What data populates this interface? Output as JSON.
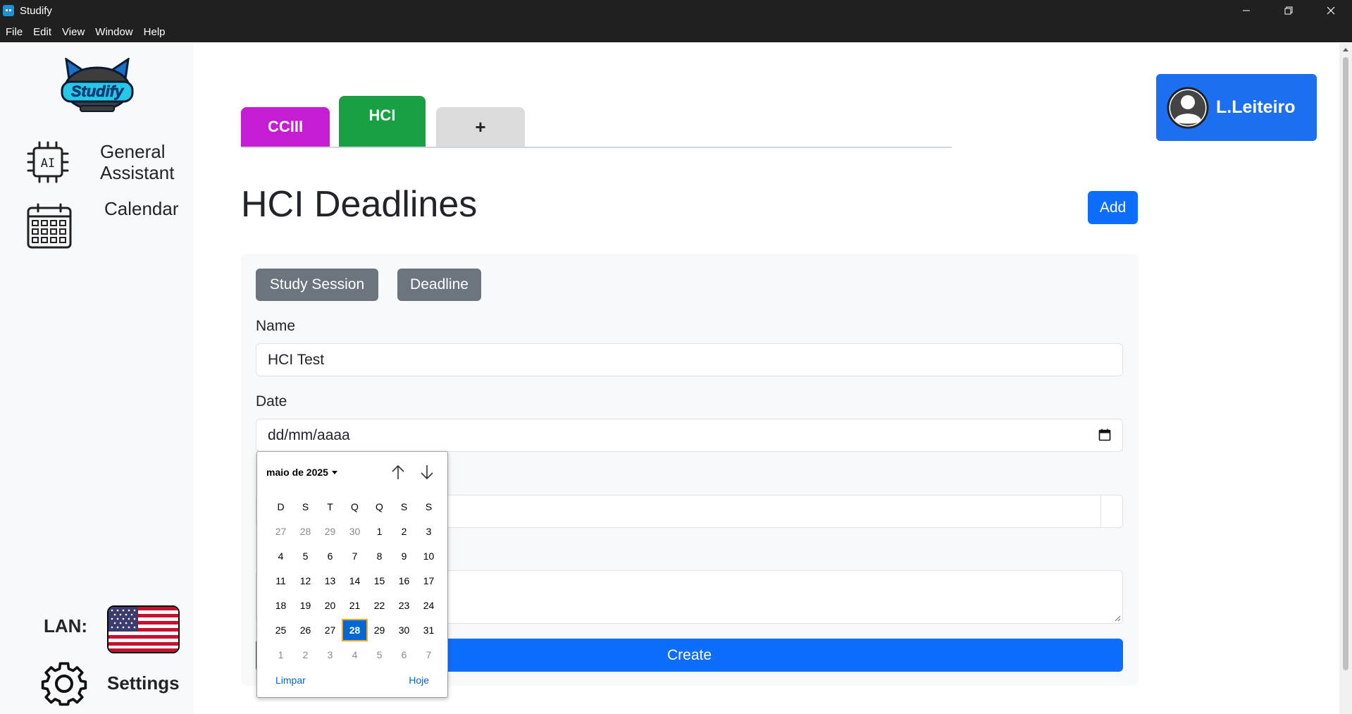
{
  "window": {
    "title": "Studify",
    "controls": {
      "minimize": "—",
      "maximize": "❐",
      "close": "✕"
    }
  },
  "menu": [
    "File",
    "Edit",
    "View",
    "Window",
    "Help"
  ],
  "sidebar": {
    "logo_text": "Studify",
    "items": [
      {
        "label_line1": "General",
        "label_line2": "Assistant",
        "icon": "ai-chip-icon"
      },
      {
        "label": "Calendar",
        "icon": "calendar-icon"
      }
    ],
    "lan_label": "LAN:",
    "language_icon": "us-flag-icon",
    "settings_label": "Settings"
  },
  "tabs": [
    {
      "label": "CCIII",
      "color": "#c41dd4"
    },
    {
      "label": "HCI",
      "color": "#19a042",
      "active": true
    },
    {
      "label": "+",
      "color": "#dcdcdc"
    }
  ],
  "user": {
    "name": "L.Leiteiro"
  },
  "page": {
    "title": "HCI Deadlines",
    "add_label": "Add"
  },
  "form": {
    "type_buttons": [
      "Study Session",
      "Deadline"
    ],
    "name_label": "Name",
    "name_value": "HCI Test",
    "date_label": "Date",
    "date_placeholder": "dd/mm/aaaa",
    "create_label": "Create"
  },
  "datepicker": {
    "month_label": "maio de 2025",
    "weekdays": [
      "D",
      "S",
      "T",
      "Q",
      "Q",
      "S",
      "S"
    ],
    "weeks": [
      [
        {
          "d": "27",
          "m": true
        },
        {
          "d": "28",
          "m": true
        },
        {
          "d": "29",
          "m": true
        },
        {
          "d": "30",
          "m": true
        },
        {
          "d": "1"
        },
        {
          "d": "2"
        },
        {
          "d": "3"
        }
      ],
      [
        {
          "d": "4"
        },
        {
          "d": "5"
        },
        {
          "d": "6"
        },
        {
          "d": "7"
        },
        {
          "d": "8"
        },
        {
          "d": "9"
        },
        {
          "d": "10"
        }
      ],
      [
        {
          "d": "11"
        },
        {
          "d": "12"
        },
        {
          "d": "13"
        },
        {
          "d": "14"
        },
        {
          "d": "15"
        },
        {
          "d": "16"
        },
        {
          "d": "17"
        }
      ],
      [
        {
          "d": "18"
        },
        {
          "d": "19"
        },
        {
          "d": "20"
        },
        {
          "d": "21"
        },
        {
          "d": "22"
        },
        {
          "d": "23"
        },
        {
          "d": "24"
        }
      ],
      [
        {
          "d": "25"
        },
        {
          "d": "26"
        },
        {
          "d": "27"
        },
        {
          "d": "28",
          "sel": true
        },
        {
          "d": "29"
        },
        {
          "d": "30"
        },
        {
          "d": "31"
        }
      ],
      [
        {
          "d": "1",
          "m": true
        },
        {
          "d": "2",
          "m": true
        },
        {
          "d": "3",
          "m": true
        },
        {
          "d": "4",
          "m": true
        },
        {
          "d": "5",
          "m": true
        },
        {
          "d": "6",
          "m": true
        },
        {
          "d": "7",
          "m": true
        }
      ]
    ],
    "clear_label": "Limpar",
    "today_label": "Hoje"
  },
  "colors": {
    "primary": "#0d6efd",
    "secondary": "#6c757d",
    "sidebar_bg": "#f8f9fa"
  }
}
